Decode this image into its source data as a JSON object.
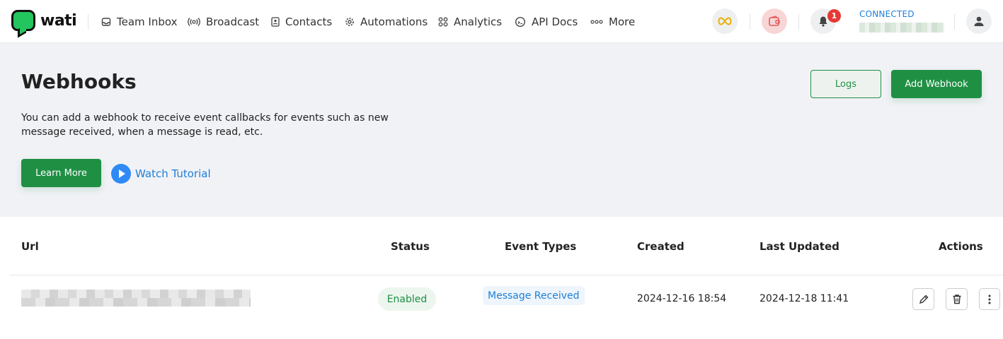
{
  "brand": {
    "name": "wati"
  },
  "nav": {
    "items": [
      {
        "label": "Team Inbox",
        "icon": "inbox-icon"
      },
      {
        "label": "Broadcast",
        "icon": "broadcast-icon"
      },
      {
        "label": "Contacts",
        "icon": "contacts-icon"
      },
      {
        "label": "Automations",
        "icon": "automations-gear-icon"
      },
      {
        "label": "Analytics",
        "icon": "analytics-grid-icon"
      },
      {
        "label": "API Docs",
        "icon": "api-docs-icon"
      },
      {
        "label": "More",
        "icon": "more-dots-icon"
      }
    ],
    "notification_count": "1",
    "connection_status": "CONNECTED"
  },
  "header": {
    "title": "Webhooks",
    "description": "You can add a webhook to receive event callbacks for events such as new message received, when a message is read, etc.",
    "logs_label": "Logs",
    "add_label": "Add Webhook",
    "learn_more_label": "Learn More",
    "watch_tutorial_label": "Watch Tutorial"
  },
  "table": {
    "columns": [
      "Url",
      "Status",
      "Event Types",
      "Created",
      "Last Updated",
      "Actions"
    ],
    "rows": [
      {
        "status": "Enabled",
        "event_types": "Message Received",
        "created": "2024-12-16 18:54",
        "last_updated": "2024-12-18 11:41"
      }
    ]
  },
  "colors": {
    "brand_green": "#1f8f44",
    "link_blue": "#1e7fd6",
    "badge_red": "#e53935",
    "hero_bg": "#f1f2f6"
  }
}
